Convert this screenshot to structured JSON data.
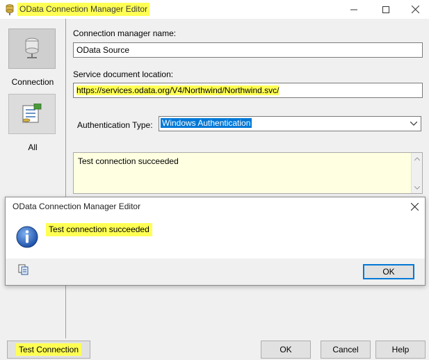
{
  "window": {
    "title": "OData Connection Manager Editor",
    "controls": {
      "minimize": "minimize-icon",
      "maximize": "maximize-icon",
      "close": "close-icon"
    }
  },
  "sidebar": {
    "items": [
      {
        "label": "Connection",
        "icon": "database-connection-icon",
        "selected": true
      },
      {
        "label": "All",
        "icon": "properties-list-icon",
        "selected": false
      }
    ]
  },
  "form": {
    "connection_name_label": "Connection manager name:",
    "connection_name_value": "OData Source",
    "service_location_label": "Service document location:",
    "service_location_value": "https://services.odata.org/V4/Northwind/Northwind.svc/",
    "auth_type_label": "Authentication Type:",
    "auth_type_value": "Windows Authentication",
    "result_text": "Test connection succeeded"
  },
  "message_box": {
    "title": "OData Connection Manager Editor",
    "message": "Test connection succeeded",
    "icon": "info-icon",
    "ok_label": "OK"
  },
  "footer": {
    "test_connection_label": "Test Connection",
    "ok_label": "OK",
    "cancel_label": "Cancel",
    "help_label": "Help"
  },
  "colors": {
    "highlight": "#ffff54",
    "selection": "#0078d7",
    "result_background": "#ffffe1",
    "dialog_background": "#f0f0f0"
  }
}
